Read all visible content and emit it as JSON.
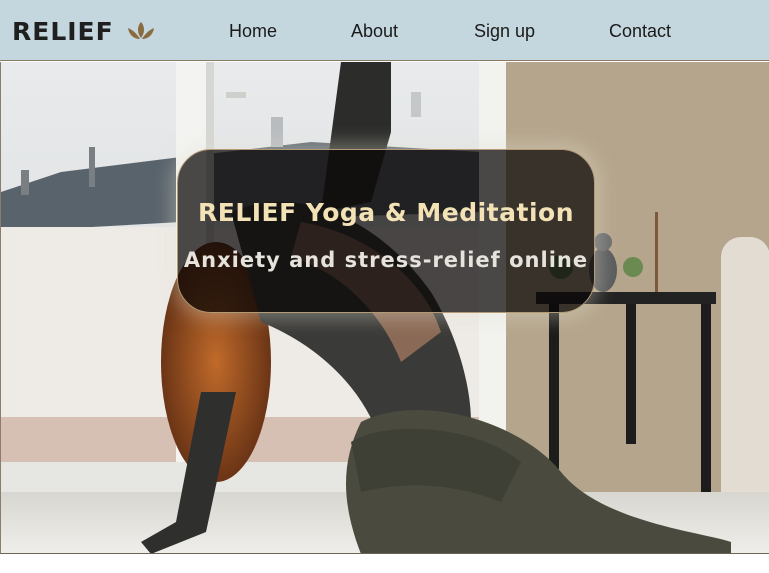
{
  "header": {
    "brand": "RELIEF",
    "brand_icon": "lotus-icon",
    "nav": {
      "home": "Home",
      "about": "About",
      "signup": "Sign up",
      "contact": "Contact"
    }
  },
  "hero": {
    "title": "RELIEF Yoga & Meditation",
    "subtitle": "Anxiety and stress-relief online"
  },
  "colors": {
    "header_bg": "#c4d6de",
    "brand_icon": "#8a6a3f",
    "hero_title": "#f3e2b5",
    "hero_subtitle": "#e6e3dc",
    "card_border": "#b29a74"
  }
}
